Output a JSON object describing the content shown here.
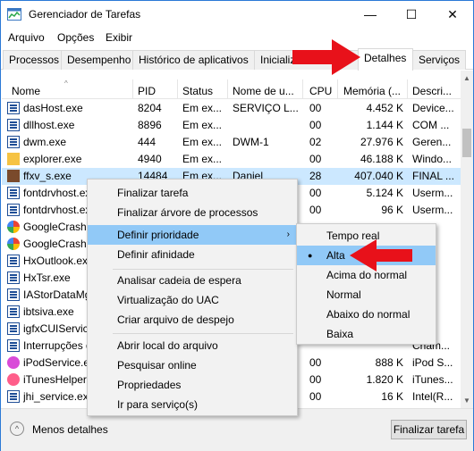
{
  "window": {
    "title": "Gerenciador de Tarefas",
    "min_glyph": "—",
    "max_glyph": "☐",
    "close_glyph": "✕"
  },
  "menubar": {
    "items": [
      "Arquivo",
      "Opções",
      "Exibir"
    ]
  },
  "tabs": [
    "Processos",
    "Desempenho",
    "Histórico de aplicativos",
    "Inicializ",
    "Detalhes",
    "Serviços"
  ],
  "active_tab": "Detalhes",
  "columns": [
    "Nome",
    "PID",
    "Status",
    "Nome de u...",
    "CPU",
    "Memória (...",
    "Descri..."
  ],
  "sort_glyph": "^",
  "rows": [
    {
      "name": "dasHost.exe",
      "pid": "8204",
      "status": "Em ex...",
      "user": "SERVIÇO L...",
      "cpu": "00",
      "mem": "4.452 K",
      "desc": "Device...",
      "icon": "window"
    },
    {
      "name": "dllhost.exe",
      "pid": "8896",
      "status": "Em ex...",
      "user": "",
      "cpu": "00",
      "mem": "1.144 K",
      "desc": "COM ...",
      "icon": "window"
    },
    {
      "name": "dwm.exe",
      "pid": "444",
      "status": "Em ex...",
      "user": "DWM-1",
      "cpu": "02",
      "mem": "27.976 K",
      "desc": "Geren...",
      "icon": "window"
    },
    {
      "name": "explorer.exe",
      "pid": "4940",
      "status": "Em ex...",
      "user": "",
      "cpu": "00",
      "mem": "46.188 K",
      "desc": "Windo...",
      "icon": "folder"
    },
    {
      "name": "ffxv_s.exe",
      "pid": "14484",
      "status": "Em ex...",
      "user": "Daniel",
      "cpu": "28",
      "mem": "407.040 K",
      "desc": "FINAL ...",
      "icon": "game"
    },
    {
      "name": "fontdrvhost.exe",
      "pid": "",
      "status": "",
      "user": "",
      "cpu": "00",
      "mem": "5.124 K",
      "desc": "Userm...",
      "icon": "window"
    },
    {
      "name": "fontdrvhost.exe",
      "pid": "",
      "status": "",
      "user": "",
      "cpu": "00",
      "mem": "96 K",
      "desc": "Userm...",
      "icon": "window"
    },
    {
      "name": "GoogleCrashH",
      "pid": "",
      "status": "",
      "user": "",
      "cpu": "",
      "mem": "",
      "desc": "",
      "icon": "google"
    },
    {
      "name": "GoogleCrashH",
      "pid": "",
      "status": "",
      "user": "",
      "cpu": "",
      "mem": "",
      "desc": "",
      "icon": "google"
    },
    {
      "name": "HxOutlook.exe",
      "pid": "",
      "status": "",
      "user": "",
      "cpu": "",
      "mem": "",
      "desc": "",
      "icon": "window"
    },
    {
      "name": "HxTsr.exe",
      "pid": "",
      "status": "",
      "user": "",
      "cpu": "",
      "mem": "",
      "desc": "",
      "icon": "window"
    },
    {
      "name": "IAStorDataMg",
      "pid": "",
      "status": "",
      "user": "",
      "cpu": "",
      "mem": "",
      "desc": "",
      "icon": "window"
    },
    {
      "name": "ibtsiva.exe",
      "pid": "",
      "status": "",
      "user": "",
      "cpu": "",
      "mem": "",
      "desc": "",
      "icon": "window"
    },
    {
      "name": "igfxCUIService",
      "pid": "",
      "status": "",
      "user": "",
      "cpu": "",
      "mem": "",
      "desc": "",
      "icon": "window"
    },
    {
      "name": "Interrupções d",
      "pid": "",
      "status": "",
      "user": "",
      "cpu": "",
      "mem": "",
      "desc": "Cham...",
      "icon": "window"
    },
    {
      "name": "iPodService.exe",
      "pid": "",
      "status": "",
      "user": "",
      "cpu": "00",
      "mem": "888 K",
      "desc": "iPod S...",
      "icon": "ipod"
    },
    {
      "name": "iTunesHelper.e",
      "pid": "",
      "status": "",
      "user": "",
      "cpu": "00",
      "mem": "1.820 K",
      "desc": "iTunes...",
      "icon": "itunes"
    },
    {
      "name": "jhi_service.exe",
      "pid": "",
      "status": "",
      "user": "",
      "cpu": "00",
      "mem": "16 K",
      "desc": "Intel(R...",
      "icon": "window"
    }
  ],
  "context_menu": {
    "items": [
      "Finalizar tarefa",
      "Finalizar árvore de processos",
      "Definir prioridade",
      "Definir afinidade",
      "Analisar cadeia de espera",
      "Virtualização do UAC",
      "Criar arquivo de despejo",
      "Abrir local do arquivo",
      "Pesquisar online",
      "Propriedades",
      "Ir para serviço(s)"
    ],
    "submenu_arrow": "›"
  },
  "priority_submenu": {
    "items": [
      "Tempo real",
      "Alta",
      "Acima do normal",
      "Normal",
      "Abaixo do normal",
      "Baixa"
    ],
    "selected": "Alta",
    "bullet": "●"
  },
  "bottom": {
    "less_details": "Menos detalhes",
    "finish_button": "Finalizar tarefa",
    "less_details_glyph": "^"
  },
  "colors": {
    "selection": "#cce8ff",
    "menu_highlight": "#91c9f7",
    "arrow": "#e8111a"
  }
}
